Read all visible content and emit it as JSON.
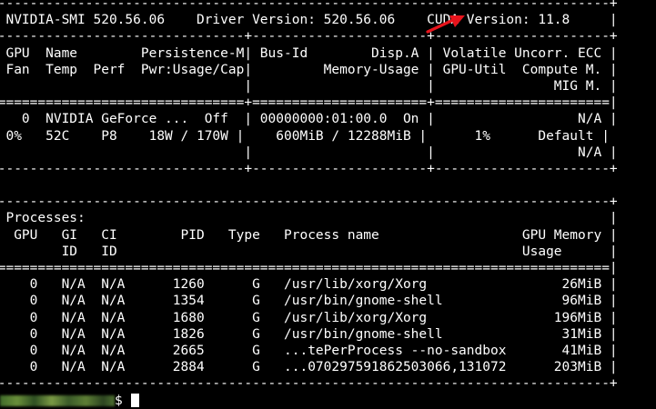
{
  "terminal": {
    "lines": [
      "+-----------------------------------------------------------------------------+",
      "| NVIDIA-SMI 520.56.06    Driver Version: 520.56.06    CUDA Version: 11.8     |",
      "|-------------------------------+----------------------+----------------------+",
      "| GPU  Name        Persistence-M| Bus-Id        Disp.A | Volatile Uncorr. ECC |",
      "| Fan  Temp  Perf  Pwr:Usage/Cap|         Memory-Usage | GPU-Util  Compute M. |",
      "|                               |                      |               MIG M. |",
      "|===============================+======================+======================|",
      "|   0  NVIDIA GeForce ...  Off  | 00000000:01:00.0  On |                  N/A |",
      "| 0%   52C    P8    18W / 170W |    600MiB / 12288MiB |      1%      Default |",
      "|                               |                      |                  N/A |",
      "+-------------------------------+----------------------+----------------------+",
      "                                                                               ",
      "+-----------------------------------------------------------------------------+",
      "| Processes:                                                                  |",
      "|  GPU   GI   CI        PID   Type   Process name                  GPU Memory |",
      "|        ID   ID                                                   Usage      |",
      "|=============================================================================|",
      "|    0   N/A  N/A      1260      G   /usr/lib/xorg/Xorg                 26MiB |",
      "|    0   N/A  N/A      1354      G   /usr/bin/gnome-shell               96MiB |",
      "|    0   N/A  N/A      1680      G   /usr/lib/xorg/Xorg                196MiB |",
      "|    0   N/A  N/A      1826      G   /usr/bin/gnome-shell               31MiB |",
      "|    0   N/A  N/A      2665      G   ...tePerProcess --no-sandbox       41MiB |",
      "|    0   N/A  N/A      2884      G   ...070297591862503066,131072      203MiB |",
      "+-----------------------------------------------------------------------------+"
    ],
    "prompt_symbol": "$"
  },
  "colors": {
    "background": "#000000",
    "text": "#ffffff",
    "annotation_arrow": "#e8141c"
  }
}
